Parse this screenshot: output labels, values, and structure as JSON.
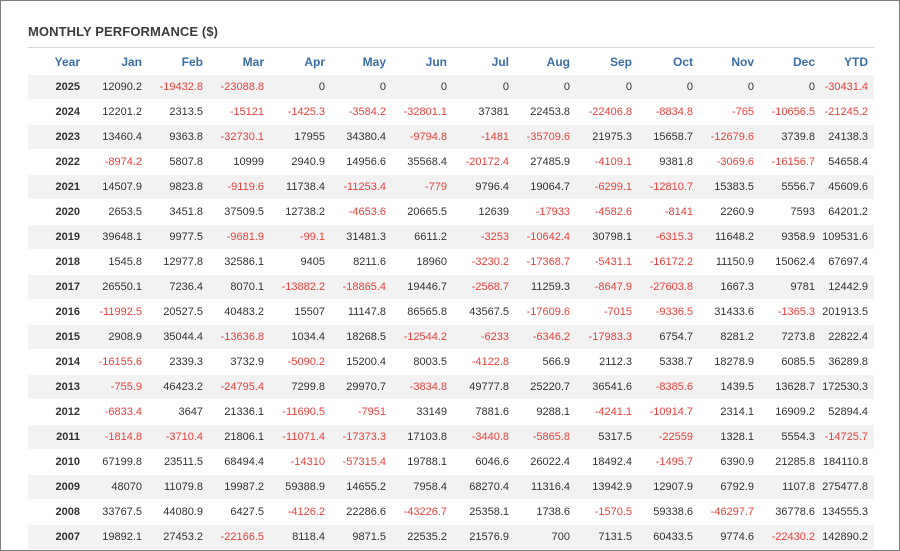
{
  "title": "MONTHLY PERFORMANCE ($)",
  "colors": {
    "header": "#3b6ea6",
    "negative": "#e8413c",
    "text": "#333333"
  },
  "headers": [
    "Year",
    "Jan",
    "Feb",
    "Mar",
    "Apr",
    "May",
    "Jun",
    "Jul",
    "Aug",
    "Sep",
    "Oct",
    "Nov",
    "Dec",
    "YTD"
  ],
  "rows": [
    [
      "2025",
      "12090.2",
      "-19432.8",
      "-23088.8",
      "0",
      "0",
      "0",
      "0",
      "0",
      "0",
      "0",
      "0",
      "0",
      "-30431.4"
    ],
    [
      "2024",
      "12201.2",
      "2313.5",
      "-15121",
      "-1425.3",
      "-3584.2",
      "-32801.1",
      "37381",
      "22453.8",
      "-22406.8",
      "-8834.8",
      "-765",
      "-10656.5",
      "-21245.2"
    ],
    [
      "2023",
      "13460.4",
      "9363.8",
      "-32730.1",
      "17955",
      "34380.4",
      "-9794.8",
      "-1481",
      "-35709.6",
      "21975.3",
      "15658.7",
      "-12679.6",
      "3739.8",
      "24138.3"
    ],
    [
      "2022",
      "-8974.2",
      "5807.8",
      "10999",
      "2940.9",
      "14956.6",
      "35568.4",
      "-20172.4",
      "27485.9",
      "-4109.1",
      "9381.8",
      "-3069.6",
      "-16156.7",
      "54658.4"
    ],
    [
      "2021",
      "14507.9",
      "9823.8",
      "-9119.6",
      "11738.4",
      "-11253.4",
      "-779",
      "9796.4",
      "19064.7",
      "-6299.1",
      "-12810.7",
      "15383.5",
      "5556.7",
      "45609.6"
    ],
    [
      "2020",
      "2653.5",
      "3451.8",
      "37509.5",
      "12738.2",
      "-4653.6",
      "20665.5",
      "12639",
      "-17933",
      "-4582.6",
      "-8141",
      "2260.9",
      "7593",
      "64201.2"
    ],
    [
      "2019",
      "39648.1",
      "9977.5",
      "-9681.9",
      "-99.1",
      "31481.3",
      "6611.2",
      "-3253",
      "-10642.4",
      "30798.1",
      "-6315.3",
      "11648.2",
      "9358.9",
      "109531.6"
    ],
    [
      "2018",
      "1545.8",
      "12977.8",
      "32586.1",
      "9405",
      "8211.6",
      "18960",
      "-3230.2",
      "-17368.7",
      "-5431.1",
      "-16172.2",
      "11150.9",
      "15062.4",
      "67697.4"
    ],
    [
      "2017",
      "26550.1",
      "7236.4",
      "8070.1",
      "-13882.2",
      "-18865.4",
      "19446.7",
      "-2568.7",
      "11259.3",
      "-8647.9",
      "-27603.8",
      "1667.3",
      "9781",
      "12442.9"
    ],
    [
      "2016",
      "-11992.5",
      "20527.5",
      "40483.2",
      "15507",
      "11147.8",
      "86565.8",
      "43567.5",
      "-17609.6",
      "-7015",
      "-9336.5",
      "31433.6",
      "-1365.3",
      "201913.5"
    ],
    [
      "2015",
      "2908.9",
      "35044.4",
      "-13636.8",
      "1034.4",
      "18268.5",
      "-12544.2",
      "-6233",
      "-6346.2",
      "-17983.3",
      "6754.7",
      "8281.2",
      "7273.8",
      "22822.4"
    ],
    [
      "2014",
      "-16155.6",
      "2339.3",
      "3732.9",
      "-5090.2",
      "15200.4",
      "8003.5",
      "-4122.8",
      "566.9",
      "2112.3",
      "5338.7",
      "18278.9",
      "6085.5",
      "36289.8"
    ],
    [
      "2013",
      "-755.9",
      "46423.2",
      "-24795.4",
      "7299.8",
      "29970.7",
      "-3834.8",
      "49777.8",
      "25220.7",
      "36541.6",
      "-8385.6",
      "1439.5",
      "13628.7",
      "172530.3"
    ],
    [
      "2012",
      "-6833.4",
      "3647",
      "21336.1",
      "-11690.5",
      "-7951",
      "33149",
      "7881.6",
      "9288.1",
      "-4241.1",
      "-10914.7",
      "2314.1",
      "16909.2",
      "52894.4"
    ],
    [
      "2011",
      "-1814.8",
      "-3710.4",
      "21806.1",
      "-11071.4",
      "-17373.3",
      "17103.8",
      "-3440.8",
      "-5865.8",
      "5317.5",
      "-22559",
      "1328.1",
      "5554.3",
      "-14725.7"
    ],
    [
      "2010",
      "67199.8",
      "23511.5",
      "68494.4",
      "-14310",
      "-57315.4",
      "19788.1",
      "6046.6",
      "26022.4",
      "18492.4",
      "-1495.7",
      "6390.9",
      "21285.8",
      "184110.8"
    ],
    [
      "2009",
      "48070",
      "11079.8",
      "19987.2",
      "59388.9",
      "14655.2",
      "7958.4",
      "68270.4",
      "11316.4",
      "13942.9",
      "12907.9",
      "6792.9",
      "1107.8",
      "275477.8"
    ],
    [
      "2008",
      "33767.5",
      "44080.9",
      "6427.5",
      "-4126.2",
      "22286.6",
      "-43226.7",
      "25358.1",
      "1738.6",
      "-1570.5",
      "59338.6",
      "-46297.7",
      "36778.6",
      "134555.3"
    ],
    [
      "2007",
      "19892.1",
      "27453.2",
      "-22166.5",
      "8118.4",
      "9871.5",
      "22535.2",
      "21576.9",
      "700",
      "7131.5",
      "60433.5",
      "9774.6",
      "-22430.2",
      "142890.2"
    ]
  ]
}
